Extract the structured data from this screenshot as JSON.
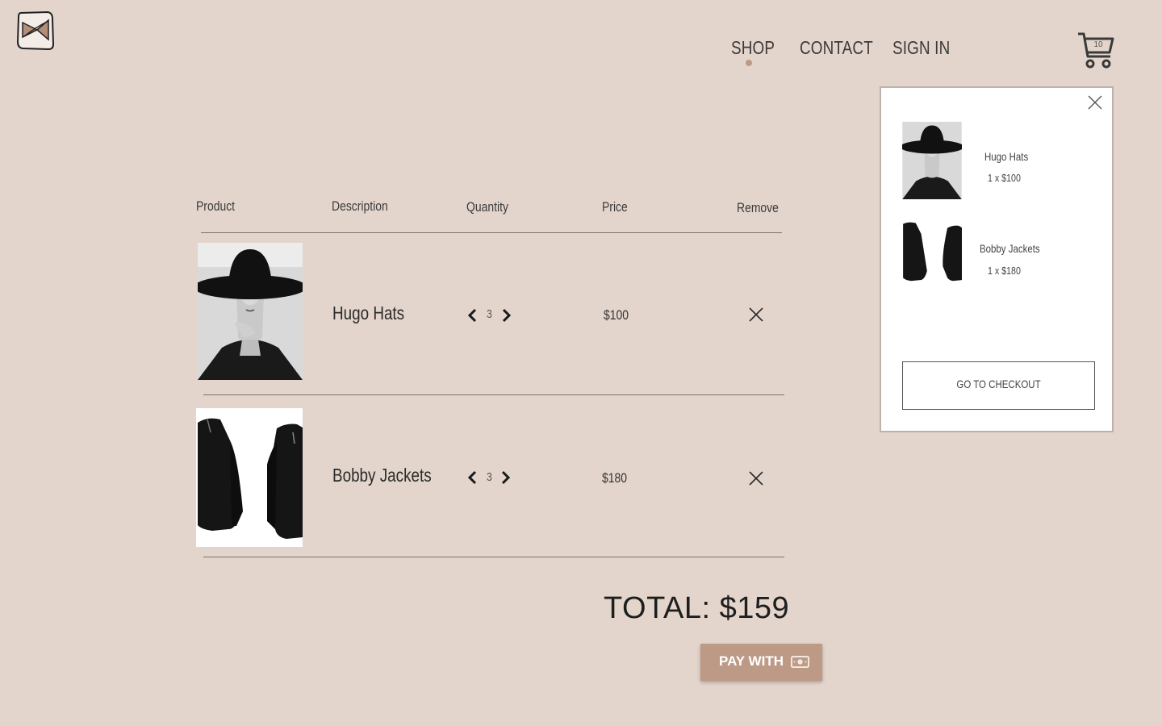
{
  "nav": {
    "items": [
      {
        "label": "SHOP",
        "active": true
      },
      {
        "label": "CONTACT",
        "active": false
      },
      {
        "label": "SIGN IN",
        "active": false
      }
    ],
    "cart_count": "10",
    "active_indicator_color": "#bd9a86"
  },
  "table": {
    "headers": [
      "Product",
      "Description",
      "Quantity",
      "Price",
      "Remove"
    ],
    "rows": [
      {
        "name": "Hugo Hats",
        "quantity": "3",
        "price": "$100",
        "image": "hat-model-image"
      },
      {
        "name": "Bobby Jackets",
        "quantity": "3",
        "price": "$180",
        "image": "jacket-image"
      }
    ]
  },
  "total": "TOTAL: $159",
  "pay": {
    "label": "PAY WITH",
    "icon": "cash-icon",
    "color": "#bd9a86"
  },
  "mini_cart": {
    "items": [
      {
        "name": "Hugo Hats",
        "line": "1 x $100"
      },
      {
        "name": "Bobby Jackets",
        "line": "1 x $180"
      }
    ],
    "checkout_label": "GO TO CHECKOUT"
  },
  "colors": {
    "background": "#e3d5cc",
    "accent": "#bd9a86"
  }
}
